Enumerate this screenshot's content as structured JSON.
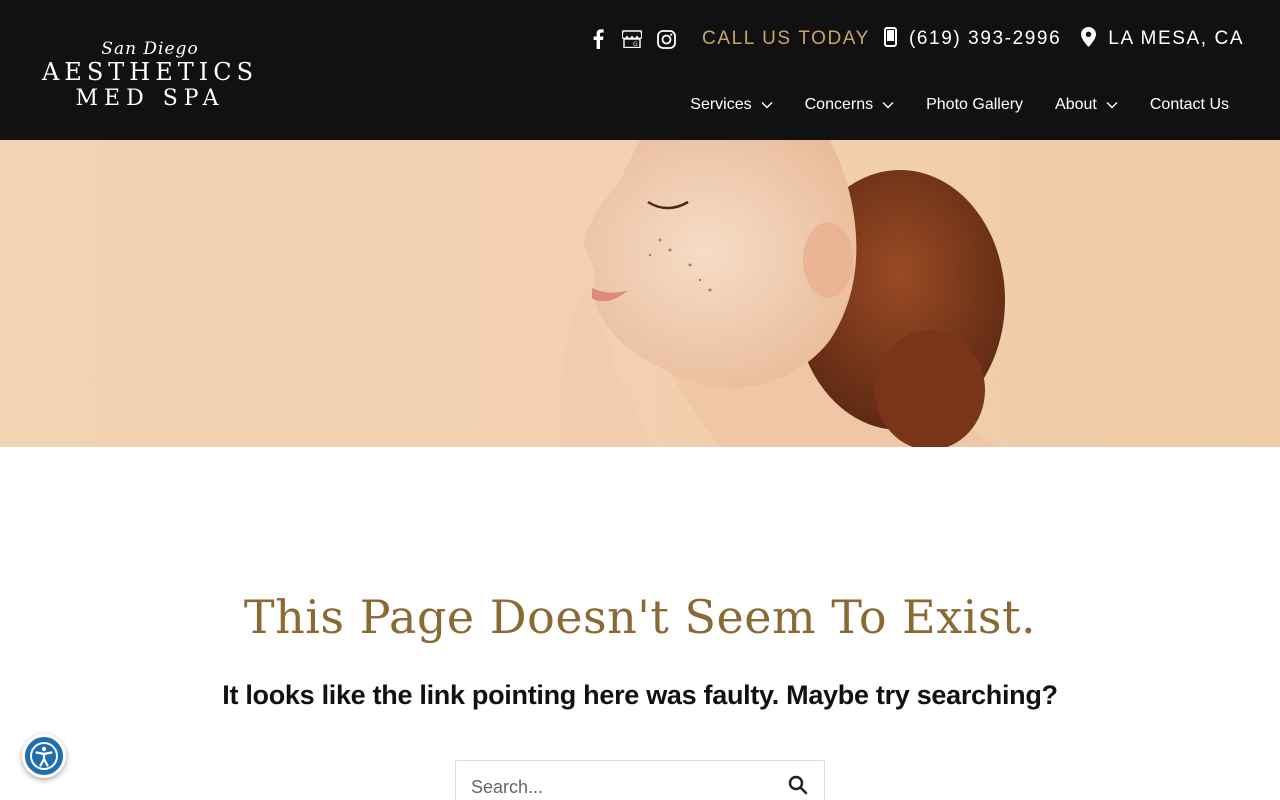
{
  "brand": {
    "logo_script": "San Diego",
    "logo_main": "AESTHETICS",
    "logo_sub": "MED SPA"
  },
  "topbar": {
    "social_icons": [
      "facebook-icon",
      "google-business-icon",
      "instagram-icon"
    ],
    "call_label": "CALL US TODAY",
    "phone": "(619) 393-2996",
    "location": "LA MESA, CA"
  },
  "nav": {
    "items": [
      {
        "label": "Services",
        "has_dropdown": true
      },
      {
        "label": "Concerns",
        "has_dropdown": true
      },
      {
        "label": "Photo Gallery",
        "has_dropdown": false
      },
      {
        "label": "About",
        "has_dropdown": true
      },
      {
        "label": "Contact Us",
        "has_dropdown": false
      }
    ]
  },
  "main": {
    "title": "This Page Doesn't Seem To Exist.",
    "subtitle": "It looks like the link pointing here was faulty. Maybe try searching?",
    "search_placeholder": "Search..."
  },
  "colors": {
    "header_bg": "#111111",
    "accent_gold": "#c8a467",
    "title_gold": "#8a6a33",
    "accessibility_blue": "#1f6eb0"
  }
}
